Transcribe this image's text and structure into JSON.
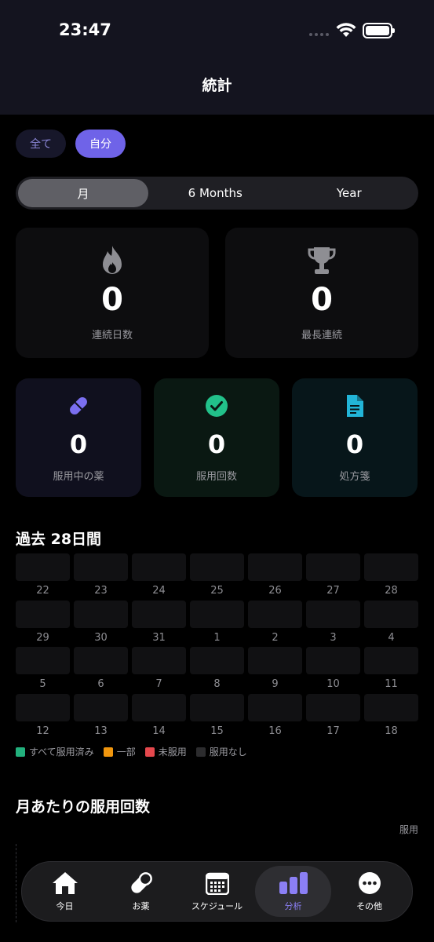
{
  "status": {
    "time": "23:47"
  },
  "header": {
    "title": "統計"
  },
  "filter_chips": [
    {
      "label": "全て",
      "selected": false
    },
    {
      "label": "自分",
      "selected": true
    }
  ],
  "period_tabs": [
    {
      "label": "月",
      "selected": true
    },
    {
      "label": "6 Months",
      "selected": false
    },
    {
      "label": "Year",
      "selected": false
    }
  ],
  "stats": {
    "streak": {
      "value": "0",
      "label": "連続日数",
      "icon": "flame-icon"
    },
    "longest": {
      "value": "0",
      "label": "最長連続",
      "icon": "trophy-icon"
    },
    "meds": {
      "value": "0",
      "label": "服用中の薬",
      "icon": "pill-icon",
      "color": "#7b6ff0"
    },
    "doses": {
      "value": "0",
      "label": "服用回数",
      "icon": "check-circle-icon",
      "color": "#22c18a"
    },
    "prescriptions": {
      "value": "0",
      "label": "処方箋",
      "icon": "document-icon",
      "color": "#22b5d8"
    }
  },
  "calendar": {
    "title": "過去 28日間",
    "days": [
      "22",
      "23",
      "24",
      "25",
      "26",
      "27",
      "28",
      "29",
      "30",
      "31",
      "1",
      "2",
      "3",
      "4",
      "5",
      "6",
      "7",
      "8",
      "9",
      "10",
      "11",
      "12",
      "13",
      "14",
      "15",
      "16",
      "17",
      "18"
    ]
  },
  "legend": [
    {
      "label": "すべて服用済み",
      "color": "#22b07d"
    },
    {
      "label": "一部",
      "color": "#f0960e"
    },
    {
      "label": "未服用",
      "color": "#e5484d"
    },
    {
      "label": "服用なし",
      "color": "#2c2c2e"
    }
  ],
  "monthly_chart": {
    "title": "月あたりの服用回数",
    "unit_label": "服用"
  },
  "tabbar": [
    {
      "label": "今日",
      "icon": "house-icon",
      "selected": false
    },
    {
      "label": "お薬",
      "icon": "pill-icon",
      "selected": false
    },
    {
      "label": "スケジュール",
      "icon": "calendar-icon",
      "selected": false
    },
    {
      "label": "分析",
      "icon": "bar-chart-icon",
      "selected": true
    },
    {
      "label": "その他",
      "icon": "more-icon",
      "selected": false
    }
  ]
}
